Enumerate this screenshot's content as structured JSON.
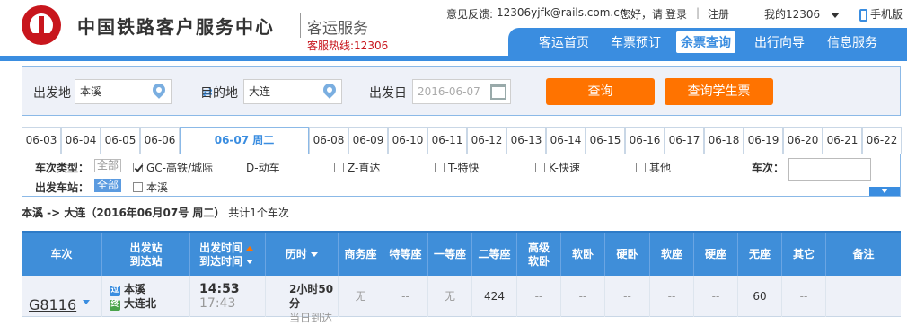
{
  "header": {
    "brand": "中国铁路客户服务中心",
    "sub": "客运服务",
    "hotline": "客服热线:12306",
    "feedback_label": "意见反馈:",
    "feedback_email": "12306yjfk@rails.com.cn",
    "greeting": "您好，请",
    "login": "登录",
    "separator": "|",
    "register": "注册",
    "my12306": "我的12306",
    "mobile": "手机版"
  },
  "nav": {
    "items": [
      "客运首页",
      "车票预订",
      "余票查询",
      "出行向导",
      "信息服务"
    ],
    "active": "余票查询"
  },
  "search": {
    "from_label": "出发地",
    "from_value": "本溪",
    "to_label": "目的地",
    "to_value": "大连",
    "date_label": "出发日",
    "date_value": "2016-06-07",
    "query_btn": "查询",
    "student_btn": "查询学生票"
  },
  "date_tabs": [
    "06-03",
    "06-04",
    "06-05",
    "06-06",
    "06-07 周二",
    "06-08",
    "06-09",
    "06-10",
    "06-11",
    "06-12",
    "06-13",
    "06-14",
    "06-15",
    "06-16",
    "06-17",
    "06-18",
    "06-19",
    "06-20",
    "06-21",
    "06-22"
  ],
  "filter": {
    "type_label": "车次类型：",
    "all": "全部",
    "types": [
      {
        "label": "GC-高铁/城际",
        "checked": true
      },
      {
        "label": "D-动车",
        "checked": false
      },
      {
        "label": "Z-直达",
        "checked": false
      },
      {
        "label": "T-特快",
        "checked": false
      },
      {
        "label": "K-快速",
        "checked": false
      },
      {
        "label": "其他",
        "checked": false
      }
    ],
    "station_label": "出发车站：",
    "stations": [
      {
        "label": "本溪",
        "checked": false
      }
    ],
    "train_no_label": "车次："
  },
  "summary": {
    "route": "本溪 -> 大连（2016年06月07号  周二）",
    "count": "共计1个车次"
  },
  "table": {
    "headers": {
      "train": "车次",
      "from_station": "出发站",
      "to_station": "到达站",
      "depart_time": "出发时间",
      "arrive_time": "到达时间",
      "duration": "历时",
      "business": "商务座",
      "premium": "特等座",
      "first": "一等座",
      "second": "二等座",
      "adv_soft_sleeper_1": "高级",
      "adv_soft_sleeper_2": "软卧",
      "soft_sleeper": "软卧",
      "hard_sleeper": "硬卧",
      "soft_seat": "软座",
      "hard_seat": "硬座",
      "no_seat": "无座",
      "other": "其它",
      "remark": "备注"
    },
    "rows": [
      {
        "train": "G8116",
        "from_badge": "过",
        "from": "本溪",
        "to_badge": "终",
        "to": "大连北",
        "depart": "14:53",
        "arrive": "17:43",
        "duration": "2小时50分",
        "arrive_day": "当日到达",
        "business": "无",
        "premium": "--",
        "first": "无",
        "second": "424",
        "adv_soft": "--",
        "soft_sleeper": "--",
        "hard_sleeper": "--",
        "soft_seat": "--",
        "hard_seat": "--",
        "no_seat": "60",
        "other": "--",
        "remark": ""
      }
    ]
  }
}
